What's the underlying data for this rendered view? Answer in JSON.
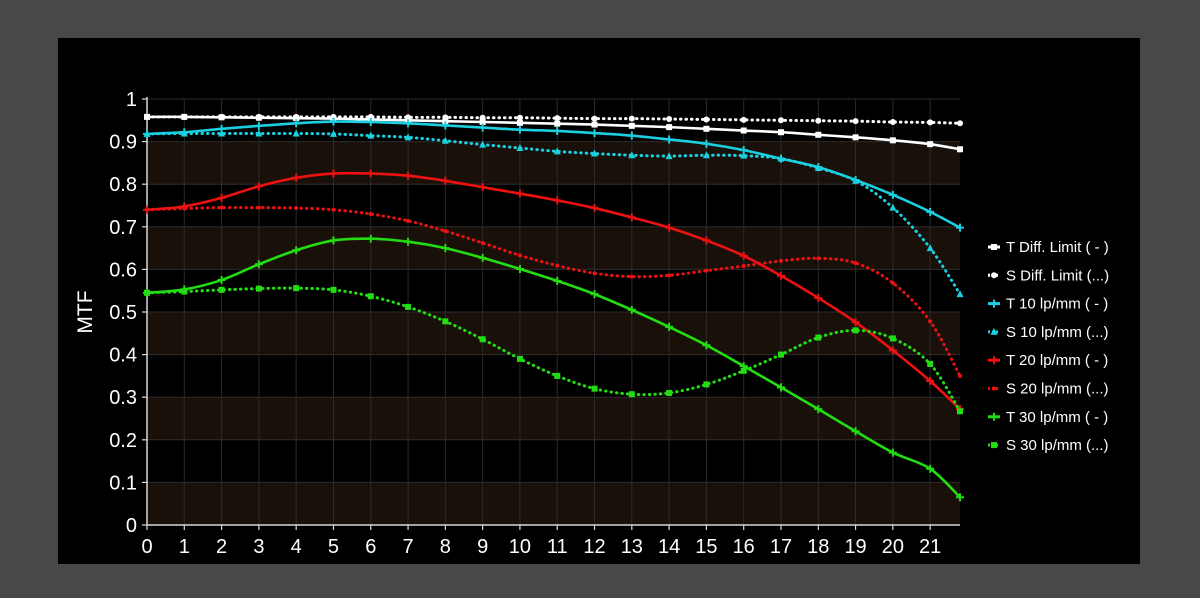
{
  "chart_data": {
    "type": "line",
    "title": "",
    "xlabel": "",
    "ylabel": "MTF",
    "xlim": [
      0,
      21.8
    ],
    "ylim": [
      0,
      1
    ],
    "x_ticks": [
      "0",
      "1",
      "2",
      "3",
      "4",
      "5",
      "6",
      "7",
      "8",
      "9",
      "10",
      "11",
      "12",
      "13",
      "14",
      "15",
      "16",
      "17",
      "18",
      "19",
      "20",
      "21"
    ],
    "y_ticks": [
      "0",
      "0.1",
      "0.2",
      "0.3",
      "0.4",
      "0.5",
      "0.6",
      "0.7",
      "0.8",
      "0.9",
      "1"
    ],
    "grid": true,
    "legend_position": "right",
    "colors": {
      "background": "#484848",
      "plot_bg": "#000000",
      "band_bg": "#1a100a",
      "white": "#ffffff",
      "cyan": "#1ad0e0",
      "red": "#ee1111",
      "green": "#22dd11"
    },
    "series": [
      {
        "name": "T Diff. Limit ( - )",
        "color": "#ffffff",
        "style": "solid",
        "marker": "square",
        "x": [
          0,
          1,
          2,
          3,
          4,
          5,
          6,
          7,
          8,
          9,
          10,
          11,
          12,
          13,
          14,
          15,
          16,
          17,
          18,
          19,
          20,
          21,
          21.8
        ],
        "y": [
          0.958,
          0.958,
          0.957,
          0.956,
          0.955,
          0.954,
          0.952,
          0.95,
          0.948,
          0.946,
          0.944,
          0.942,
          0.94,
          0.937,
          0.934,
          0.93,
          0.926,
          0.922,
          0.916,
          0.91,
          0.903,
          0.894,
          0.882
        ]
      },
      {
        "name": "S Diff. Limit (...)",
        "color": "#ffffff",
        "style": "dotted",
        "marker": "circle",
        "x": [
          0,
          1,
          2,
          3,
          4,
          5,
          6,
          7,
          8,
          9,
          10,
          11,
          12,
          13,
          14,
          15,
          16,
          17,
          18,
          19,
          20,
          21,
          21.8
        ],
        "y": [
          0.958,
          0.958,
          0.958,
          0.958,
          0.958,
          0.958,
          0.958,
          0.957,
          0.957,
          0.956,
          0.956,
          0.955,
          0.954,
          0.954,
          0.953,
          0.952,
          0.951,
          0.95,
          0.949,
          0.948,
          0.946,
          0.945,
          0.943
        ]
      },
      {
        "name": "T 10 lp/mm ( - )",
        "color": "#1ad0e0",
        "style": "solid",
        "marker": "cross",
        "x": [
          0,
          1,
          2,
          3,
          4,
          5,
          6,
          7,
          8,
          9,
          10,
          11,
          12,
          13,
          14,
          15,
          16,
          17,
          18,
          19,
          20,
          21,
          21.8
        ],
        "y": [
          0.918,
          0.922,
          0.93,
          0.937,
          0.943,
          0.947,
          0.946,
          0.943,
          0.938,
          0.933,
          0.928,
          0.925,
          0.92,
          0.914,
          0.905,
          0.895,
          0.88,
          0.86,
          0.84,
          0.81,
          0.775,
          0.735,
          0.698
        ]
      },
      {
        "name": "S 10 lp/mm (...)",
        "color": "#1ad0e0",
        "style": "dotted",
        "marker": "triangle",
        "x": [
          0,
          1,
          2,
          3,
          4,
          5,
          6,
          7,
          8,
          9,
          10,
          11,
          12,
          13,
          14,
          15,
          16,
          17,
          18,
          19,
          20,
          21,
          21.8
        ],
        "y": [
          0.918,
          0.919,
          0.919,
          0.919,
          0.919,
          0.918,
          0.914,
          0.91,
          0.902,
          0.893,
          0.885,
          0.877,
          0.872,
          0.868,
          0.866,
          0.868,
          0.867,
          0.86,
          0.838,
          0.808,
          0.745,
          0.65,
          0.542
        ]
      },
      {
        "name": "T 20 lp/mm ( - )",
        "color": "#ee1111",
        "style": "solid",
        "marker": "cross",
        "x": [
          0,
          1,
          2,
          3,
          4,
          5,
          6,
          7,
          8,
          9,
          10,
          11,
          12,
          13,
          14,
          15,
          16,
          17,
          18,
          19,
          20,
          21,
          21.8
        ],
        "y": [
          0.74,
          0.748,
          0.768,
          0.795,
          0.815,
          0.825,
          0.825,
          0.82,
          0.808,
          0.793,
          0.778,
          0.762,
          0.744,
          0.722,
          0.698,
          0.668,
          0.632,
          0.585,
          0.533,
          0.476,
          0.41,
          0.338,
          0.272
        ]
      },
      {
        "name": "S 20 lp/mm (...)",
        "color": "#ee1111",
        "style": "dotted",
        "marker": "dot",
        "x": [
          0,
          1,
          2,
          3,
          4,
          5,
          6,
          7,
          8,
          9,
          10,
          11,
          12,
          13,
          14,
          15,
          16,
          17,
          18,
          19,
          20,
          21,
          21.8
        ],
        "y": [
          0.74,
          0.743,
          0.745,
          0.745,
          0.744,
          0.74,
          0.73,
          0.714,
          0.69,
          0.662,
          0.633,
          0.609,
          0.591,
          0.583,
          0.586,
          0.597,
          0.608,
          0.62,
          0.626,
          0.615,
          0.568,
          0.478,
          0.35
        ]
      },
      {
        "name": "T 30 lp/mm ( - )",
        "color": "#22dd11",
        "style": "solid",
        "marker": "cross",
        "x": [
          0,
          1,
          2,
          3,
          4,
          5,
          6,
          7,
          8,
          9,
          10,
          11,
          12,
          13,
          14,
          15,
          16,
          17,
          18,
          19,
          20,
          21,
          21.8
        ],
        "y": [
          0.545,
          0.553,
          0.575,
          0.612,
          0.645,
          0.668,
          0.672,
          0.665,
          0.65,
          0.627,
          0.601,
          0.573,
          0.542,
          0.505,
          0.465,
          0.422,
          0.373,
          0.323,
          0.272,
          0.22,
          0.17,
          0.132,
          0.065
        ]
      },
      {
        "name": "S 30 lp/mm (...)",
        "color": "#22dd11",
        "style": "dotted",
        "marker": "square",
        "x": [
          0,
          1,
          2,
          3,
          4,
          5,
          6,
          7,
          8,
          9,
          10,
          11,
          12,
          13,
          14,
          15,
          16,
          17,
          18,
          19,
          20,
          21,
          21.8
        ],
        "y": [
          0.545,
          0.548,
          0.552,
          0.555,
          0.556,
          0.552,
          0.537,
          0.512,
          0.478,
          0.436,
          0.39,
          0.35,
          0.32,
          0.307,
          0.31,
          0.33,
          0.362,
          0.4,
          0.44,
          0.457,
          0.438,
          0.378,
          0.267
        ]
      }
    ]
  }
}
